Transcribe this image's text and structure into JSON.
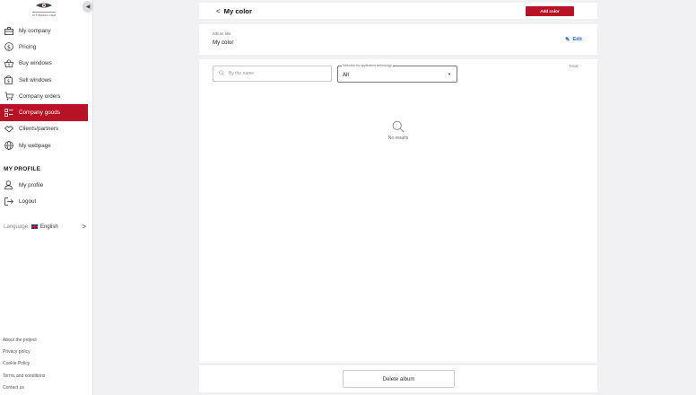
{
  "sidebar": {
    "logo_text": "CITYBASIC.COM",
    "collapse_glyph": "◀",
    "items": [
      {
        "label": "My company",
        "icon": "company-icon",
        "active": false
      },
      {
        "label": "Pricing",
        "icon": "dollar-icon",
        "active": false
      },
      {
        "label": "Buy windows",
        "icon": "basket-icon",
        "active": false
      },
      {
        "label": "Sell windows",
        "icon": "sell-icon",
        "active": false
      },
      {
        "label": "Company orders",
        "icon": "orders-icon",
        "active": false
      },
      {
        "label": "Company goods",
        "icon": "goods-icon",
        "active": true
      },
      {
        "label": "Clients/partners",
        "icon": "partners-icon",
        "active": false
      },
      {
        "label": "My webpage",
        "icon": "globe-icon",
        "active": false
      }
    ],
    "profile_heading": "MY PROFILE",
    "profile_items": [
      {
        "label": "My profile",
        "icon": "user-icon"
      },
      {
        "label": "Logout",
        "icon": "logout-icon"
      }
    ],
    "language_label": "Language:",
    "language_value": "English",
    "language_chevron": ">",
    "footer_links": [
      "About the project",
      "Privacy policy",
      "Cookie Policy",
      "Terms and conditions",
      "Contact us"
    ]
  },
  "header": {
    "back_glyph": "<",
    "title": "My color",
    "add_button": "Add color"
  },
  "album": {
    "label": "Album title",
    "value": "My color",
    "edit_button": "Edit"
  },
  "filters": {
    "search_placeholder": "By the name",
    "select_legend": "Selection by application technology",
    "select_value": "All",
    "total_label": "Total: -"
  },
  "results": {
    "empty_text": "No results"
  },
  "footer": {
    "delete_button": "Delete album"
  },
  "colors": {
    "accent": "#b81226",
    "link": "#2b6cc4",
    "background": "#f1f1f3"
  }
}
